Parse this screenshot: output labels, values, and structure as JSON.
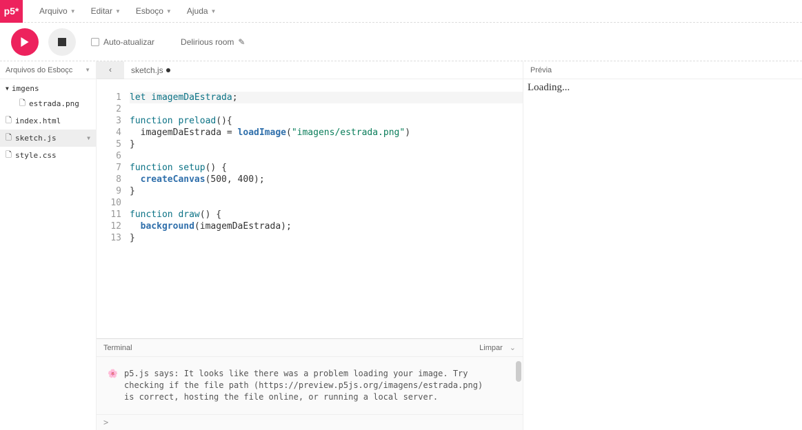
{
  "logo": "p5*",
  "menu": {
    "file": "Arquivo",
    "edit": "Editar",
    "sketch": "Esboço",
    "help": "Ajuda"
  },
  "toolbar": {
    "auto_update": "Auto-atualizar",
    "sketch_name": "Delirious room"
  },
  "sidebar": {
    "header": "Arquivos do Esboçc",
    "folder": "imgens",
    "files": {
      "estrada": "estrada.png",
      "index": "index.html",
      "sketch": "sketch.js",
      "style": "style.css"
    }
  },
  "tab": {
    "name": "sketch.js"
  },
  "code": {
    "l1a": "let",
    "l1b": " imagemDaEstrada",
    "l1c": ";",
    "l3a": "function",
    "l3b": " preload",
    "l3c": "(){",
    "l4a": "  imagemDaEstrada = ",
    "l4b": "loadImage",
    "l4c": "(",
    "l4d": "\"imagens/estrada.png\"",
    "l4e": ")",
    "l5": "}",
    "l7a": "function",
    "l7b": " setup",
    "l7c": "() {",
    "l8a": "  ",
    "l8b": "createCanvas",
    "l8c": "(",
    "l8d": "500",
    "l8e": ", ",
    "l8f": "400",
    "l8g": ");",
    "l9": "}",
    "l11a": "function",
    "l11b": " draw",
    "l11c": "() {",
    "l12a": "  ",
    "l12b": "background",
    "l12c": "(imagemDaEstrada);",
    "l13": "}"
  },
  "lines": {
    "n1": "1",
    "n2": "2",
    "n3": "3",
    "n4": "4",
    "n5": "5",
    "n6": "6",
    "n7": "7",
    "n8": "8",
    "n9": "9",
    "n10": "10",
    "n11": "11",
    "n12": "12",
    "n13": "13"
  },
  "terminal": {
    "title": "Terminal",
    "clear": "Limpar",
    "icon": "🌸",
    "msg": "p5.js says: It looks like there was a problem loading your image. Try checking if the file path (https://preview.p5js.org/imagens/estrada.png) is correct, hosting the file online, or running a local server.",
    "prompt": ">"
  },
  "preview": {
    "title": "Prévia",
    "loading": "Loading..."
  }
}
